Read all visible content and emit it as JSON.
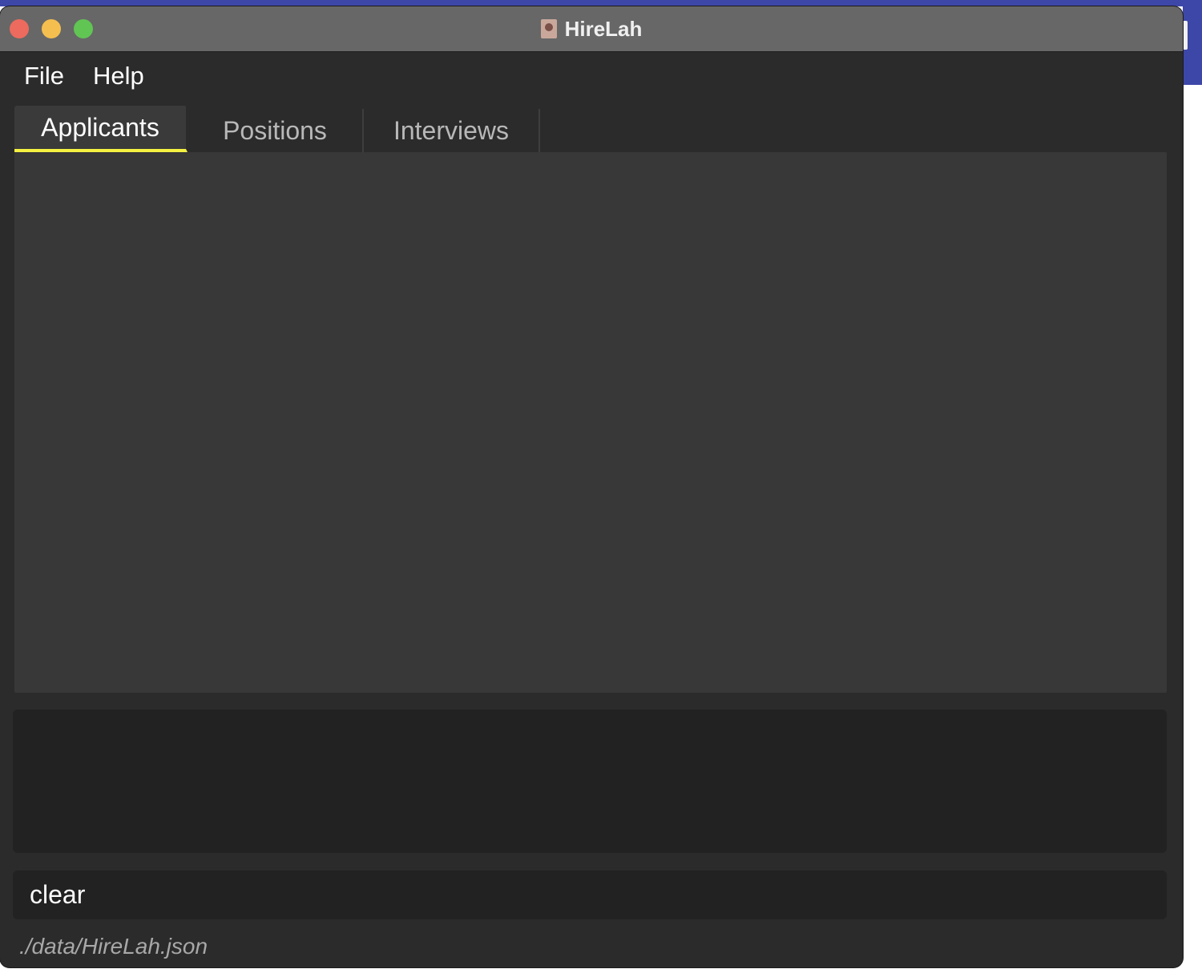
{
  "window": {
    "title": "HireLah",
    "app_icon": "hirelah-app-icon"
  },
  "menubar": {
    "items": [
      {
        "label": "File"
      },
      {
        "label": "Help"
      }
    ]
  },
  "tabs": [
    {
      "label": "Applicants",
      "active": true
    },
    {
      "label": "Positions",
      "active": false
    },
    {
      "label": "Interviews",
      "active": false
    }
  ],
  "result_display": {
    "text": ""
  },
  "command_box": {
    "value": "clear"
  },
  "status_bar": {
    "file_path": "./data/HireLah.json"
  },
  "colors": {
    "active_tab_underline": "#f5f242",
    "window_bg": "#2b2b2b",
    "panel_bg": "#383838",
    "result_bg": "#222222"
  }
}
